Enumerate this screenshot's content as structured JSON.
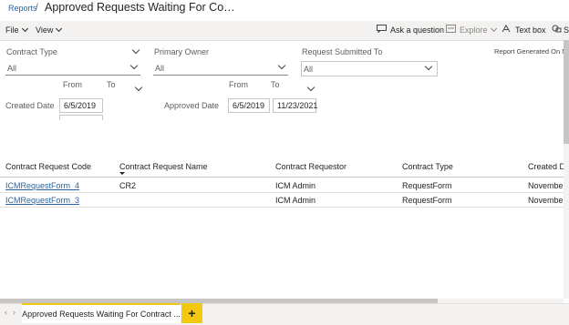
{
  "header": {
    "breadcrumb": "Reports",
    "separator": "/",
    "title": "Approved Requests Waiting For Co…"
  },
  "toolbar": {
    "file": "File",
    "view": "View",
    "ask": "Ask a question",
    "explore": "Explore",
    "textbox": "Text box",
    "more": "S"
  },
  "filters": {
    "contract_type": {
      "label": "Contract Type",
      "value": "All"
    },
    "primary_owner": {
      "label": "Primary Owner",
      "value": "All"
    },
    "request_submitted_to": {
      "label": "Request Submitted To",
      "value": "All"
    },
    "generated": "Report Generated On No",
    "created": {
      "label": "Created  Date",
      "from_label": "From",
      "to_label": "To",
      "from": "6/5/2019",
      "to": ""
    },
    "approved": {
      "label": "Approved  Date",
      "from_label": "From",
      "to_label": "To",
      "from": "6/5/2019",
      "to": "11/23/2021"
    }
  },
  "table": {
    "headers": [
      "Contract Request Code",
      "Contract Request Name",
      "Contract Requestor",
      "Contract Type",
      "Created D"
    ],
    "rows": [
      [
        "ICMRequestForm_4",
        "CR2",
        "ICM Admin",
        "RequestForm",
        "November"
      ],
      [
        "ICMRequestForm_3",
        "",
        "ICM Admin",
        "RequestForm",
        "November"
      ]
    ]
  },
  "tabs": {
    "active": "Approved Requests Waiting For Contract ...",
    "add": "+"
  },
  "colors": {
    "accent": "#f2c811",
    "link": "#2a64a6",
    "toolbar_bg": "#f3f2f1"
  }
}
